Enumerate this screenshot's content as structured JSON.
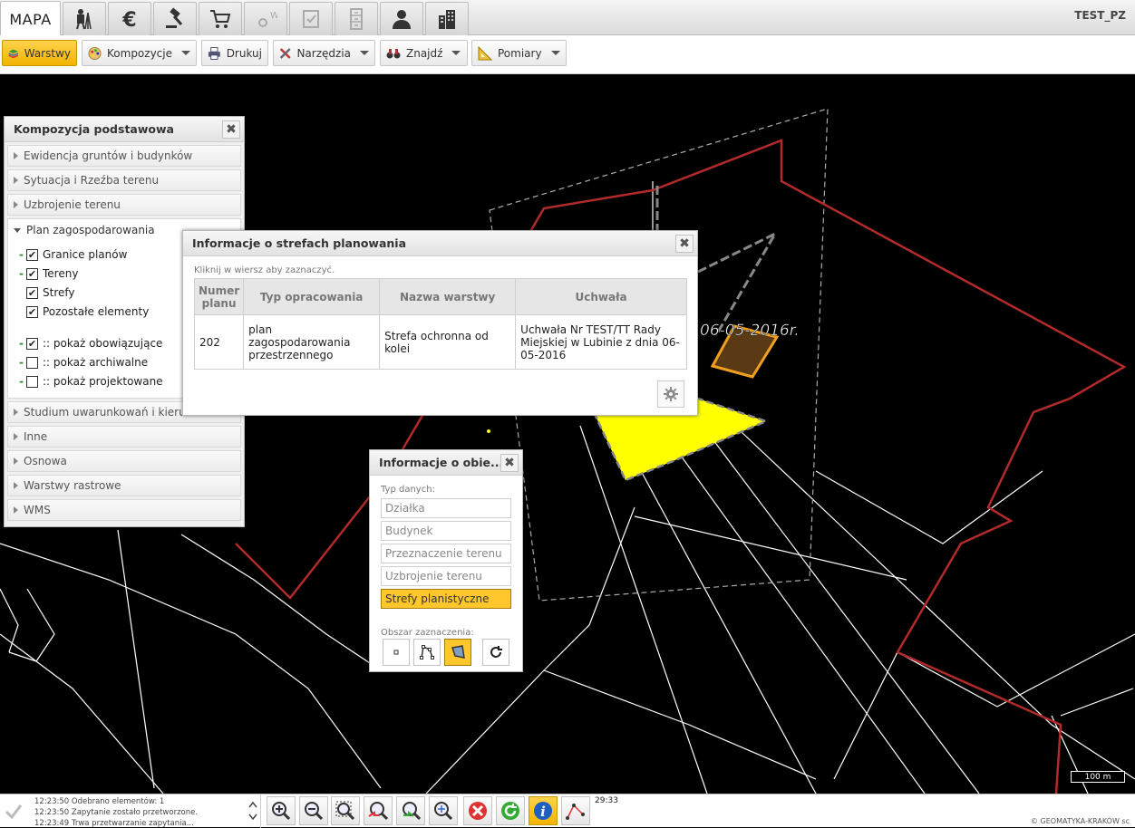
{
  "topbar": {
    "tabs": [
      {
        "id": "map",
        "label": "MAPA",
        "active": true
      },
      {
        "id": "surveyor",
        "icon": "surveyor-icon"
      },
      {
        "id": "finance",
        "icon": "euro-icon"
      },
      {
        "id": "law",
        "icon": "gavel-icon"
      },
      {
        "id": "shop",
        "icon": "cart-icon"
      },
      {
        "id": "wfs",
        "icon": "w-icon"
      },
      {
        "id": "doc",
        "icon": "document-check-icon"
      },
      {
        "id": "cabinet",
        "icon": "file-cabinet-icon"
      },
      {
        "id": "person",
        "icon": "person-icon"
      },
      {
        "id": "building",
        "icon": "buildings-icon"
      }
    ],
    "user": "TEST_PZ"
  },
  "toolbar": {
    "layers": "Warstwy",
    "compositions": "Kompozycje",
    "print": "Drukuj",
    "tools": "Narzędzia",
    "find": "Znajdź",
    "measure": "Pomiary"
  },
  "composition": {
    "title": "Kompozycja podstawowa",
    "items_before": [
      "Ewidencja gruntów i budynków",
      "Sytuacja i Rzeźba terenu",
      "Uzbrojenie terenu"
    ],
    "open_group": "Plan zagospodarowania",
    "checks": [
      {
        "label": "Granice planów",
        "checked": true,
        "dash": true
      },
      {
        "label": "Tereny",
        "checked": true,
        "dash": true
      },
      {
        "label": "Strefy",
        "checked": true,
        "dash": false
      },
      {
        "label": "Pozostałe elementy",
        "checked": true,
        "dash": false
      }
    ],
    "status_checks": [
      {
        "label": ":: pokaż obowiązujące",
        "checked": true
      },
      {
        "label": ":: pokaż archiwalne",
        "checked": false
      },
      {
        "label": ":: pokaż projektowane",
        "checked": false
      }
    ],
    "items_after": [
      "Studium uwarunkowań i kierunków",
      "Inne",
      "Osnowa",
      "Warstwy rastrowe",
      "WMS"
    ]
  },
  "info_window": {
    "title": "Informacje o strefach planowania",
    "hint": "Kliknij w wiersz aby zaznaczyć.",
    "columns": [
      "Numer planu",
      "Typ opracowania",
      "Nazwa warstwy",
      "Uchwała"
    ],
    "rows": [
      [
        "202",
        "plan zagospodarowania przestrzennego",
        "Strefa ochronna od kolei",
        "Uchwała Nr TEST/TT Rady Miejskiej w Lubinie z dnia 06-05-2016"
      ]
    ]
  },
  "object_info": {
    "title": "Informacje o obie...",
    "type_label": "Typ danych:",
    "types": [
      "Działka",
      "Budynek",
      "Przeznaczenie terenu",
      "Uzbrojenie terenu",
      "Strefy planistyczne"
    ],
    "selected_type_index": 4,
    "area_label": "Obszar zaznaczenia:",
    "selected_area_tool": "polygon"
  },
  "map": {
    "label_text": "06-05-2016r.",
    "scale": "100 m",
    "colors": {
      "boundary": "#b22a2a",
      "zone": "#ffff00",
      "parcel": "#ffffff",
      "building_fill": "#5a3a14",
      "building_stroke": "#f0a020"
    }
  },
  "bottom": {
    "log": [
      "12:23:50 Odebrano elementów: 1",
      "12:23:50 Zapytanie zostało przetworzone.",
      "12:23:49 Trwa przetwarzanie zapytania..."
    ],
    "clock": "29:33",
    "copyright": "© GEOMATYKA-KRAKÓW sc"
  }
}
